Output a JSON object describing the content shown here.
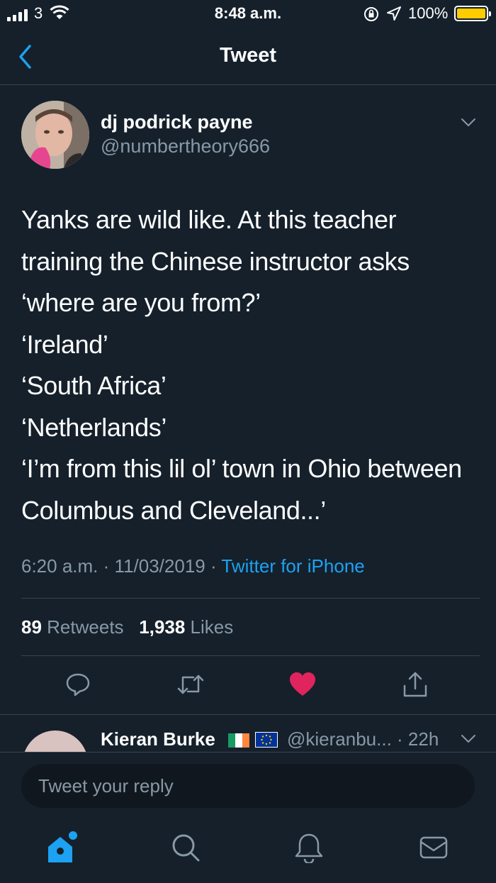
{
  "status_bar": {
    "carrier": "3",
    "time": "8:48 a.m.",
    "battery": "100%"
  },
  "nav": {
    "title": "Tweet",
    "back_icon": "chevron-left-icon"
  },
  "tweet": {
    "display_name": "dj podrick payne",
    "handle": "@numbertheory666",
    "text": "Yanks are wild like. At this teacher training the Chinese instructor asks ‘where are you from?’\n‘Ireland’\n‘South Africa’\n‘Netherlands’\n‘I’m from this lil ol’ town in Ohio between Columbus and Cleveland...’",
    "time": "6:20 a.m.",
    "date": "11/03/2019",
    "source": "Twitter for iPhone",
    "separator": "·",
    "retweets_count": "89",
    "retweets_label": "Retweets",
    "likes_count": "1,938",
    "likes_label": "Likes",
    "liked": true,
    "like_color": "#e0245e"
  },
  "reply_preview": {
    "display_name": "Kieran Burke",
    "handle": "@kieranbu...",
    "time": "· 22h"
  },
  "composer": {
    "placeholder": "Tweet your reply"
  },
  "tab_bar": {
    "tabs": [
      "home-icon",
      "search-icon",
      "notifications-icon",
      "messages-icon"
    ],
    "active": "home-icon",
    "has_new": true
  },
  "colors": {
    "background": "#15202b",
    "accent": "#1da1f2",
    "secondary_text": "#8899a6",
    "divider": "#38444d"
  }
}
